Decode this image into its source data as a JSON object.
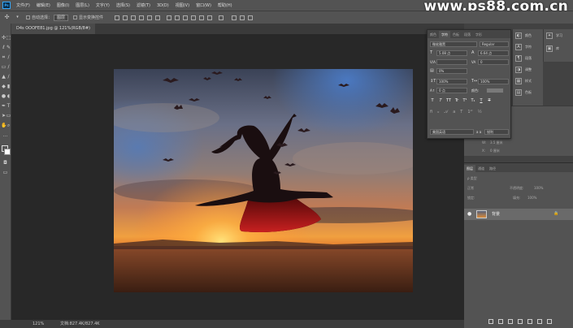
{
  "app": {
    "logo": "Ps"
  },
  "menubar": {
    "items": [
      "文件(F)",
      "编辑(E)",
      "图像(I)",
      "图层(L)",
      "文字(Y)",
      "选择(S)",
      "滤镜(T)",
      "3D(D)",
      "视图(V)",
      "窗口(W)",
      "帮助(H)"
    ]
  },
  "watermark": "www.ps88.com.cn",
  "options": {
    "auto_select_label": "自动选择：",
    "auto_select_value": "图层",
    "show_transform_label": "显示变换控件"
  },
  "document_tab": {
    "title": "D4s OOOFE81.jpg @ 121%(RGB/8#)"
  },
  "status": {
    "zoom": "121%",
    "doc_size": "文档:827.4K/827.4K"
  },
  "character_panel": {
    "tabs": [
      "颜色",
      "字符",
      "色板",
      "段落",
      "字形"
    ],
    "active_tab": 1,
    "font_family": "微软雅黑",
    "font_style": "Regular",
    "font_size": "5.08 点",
    "leading": "6.64 点",
    "kerning": "V/A",
    "tracking": "0",
    "vscale": "100%",
    "hscale": "100%",
    "baseline": "0 点",
    "color_label": "颜色:",
    "pct": "0%",
    "style_buttons": [
      "T",
      "T",
      "TT",
      "Tr",
      "T¹",
      "T₁",
      "T",
      "T"
    ],
    "language": "美国英语",
    "aa": "a a",
    "aa_mode": "锐利"
  },
  "dock": {
    "items": [
      "颜色",
      "字符",
      "段落",
      "调整",
      "样式",
      "色板"
    ],
    "items2": [
      "学习",
      "库"
    ]
  },
  "properties": {
    "w_label": "W:",
    "w_value": "3.5 厘米",
    "h_label": "X:",
    "h_value": "0 厘米"
  },
  "layers": {
    "tabs": [
      "图层",
      "通道",
      "路径"
    ],
    "filter_label": "ρ 类型",
    "blend_mode": "正常",
    "opacity_label": "不透明度:",
    "opacity": "100%",
    "lock_label": "锁定:",
    "fill_label": "填充:",
    "fill": "100%",
    "layer_name": "背景"
  },
  "colors": {
    "chrome": "#535353",
    "canvas_bg": "#282828",
    "accent": "#31a8ff"
  }
}
